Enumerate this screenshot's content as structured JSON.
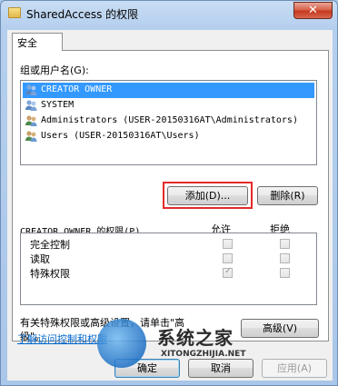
{
  "window": {
    "title": "SharedAccess 的权限",
    "close_glyph": "✕"
  },
  "tabs": [
    {
      "label": "安全"
    }
  ],
  "group_label": "组或用户名(G):",
  "users": [
    {
      "name": "CREATOR OWNER",
      "icon": "user-group-icon",
      "selected": true
    },
    {
      "name": "SYSTEM",
      "icon": "user-group-icon",
      "selected": false
    },
    {
      "name": "Administrators (USER-20150316AT\\Administrators)",
      "icon": "user-group-icon",
      "selected": false
    },
    {
      "name": "Users (USER-20150316AT\\Users)",
      "icon": "user-group-icon",
      "selected": false
    }
  ],
  "buttons": {
    "add": "添加(D)...",
    "remove": "删除(R)",
    "advanced": "高级(V)",
    "ok": "确定",
    "cancel": "取消",
    "apply": "应用(A)"
  },
  "permissions": {
    "header": "CREATOR OWNER 的权限(P)",
    "allow_label": "允许",
    "deny_label": "拒绝",
    "rows": [
      {
        "name": "完全控制",
        "allow": false,
        "deny": false
      },
      {
        "name": "读取",
        "allow": false,
        "deny": false
      },
      {
        "name": "特殊权限",
        "allow": true,
        "deny": false
      }
    ]
  },
  "advanced_note": "有关特殊权限或高级设置，请单击\"高级\"。",
  "advanced_note_line1": "有关特殊权限或高级设置，请单击\"高",
  "advanced_note_line2": "级\"。",
  "learn_link": "了解访问控制和权限",
  "watermark": {
    "text": "系统之家",
    "url": "XITONGZHIJIA.NET"
  },
  "colors": {
    "selection": "#3399ff",
    "highlight_box": "#e32a2a",
    "link": "#0066cc"
  }
}
